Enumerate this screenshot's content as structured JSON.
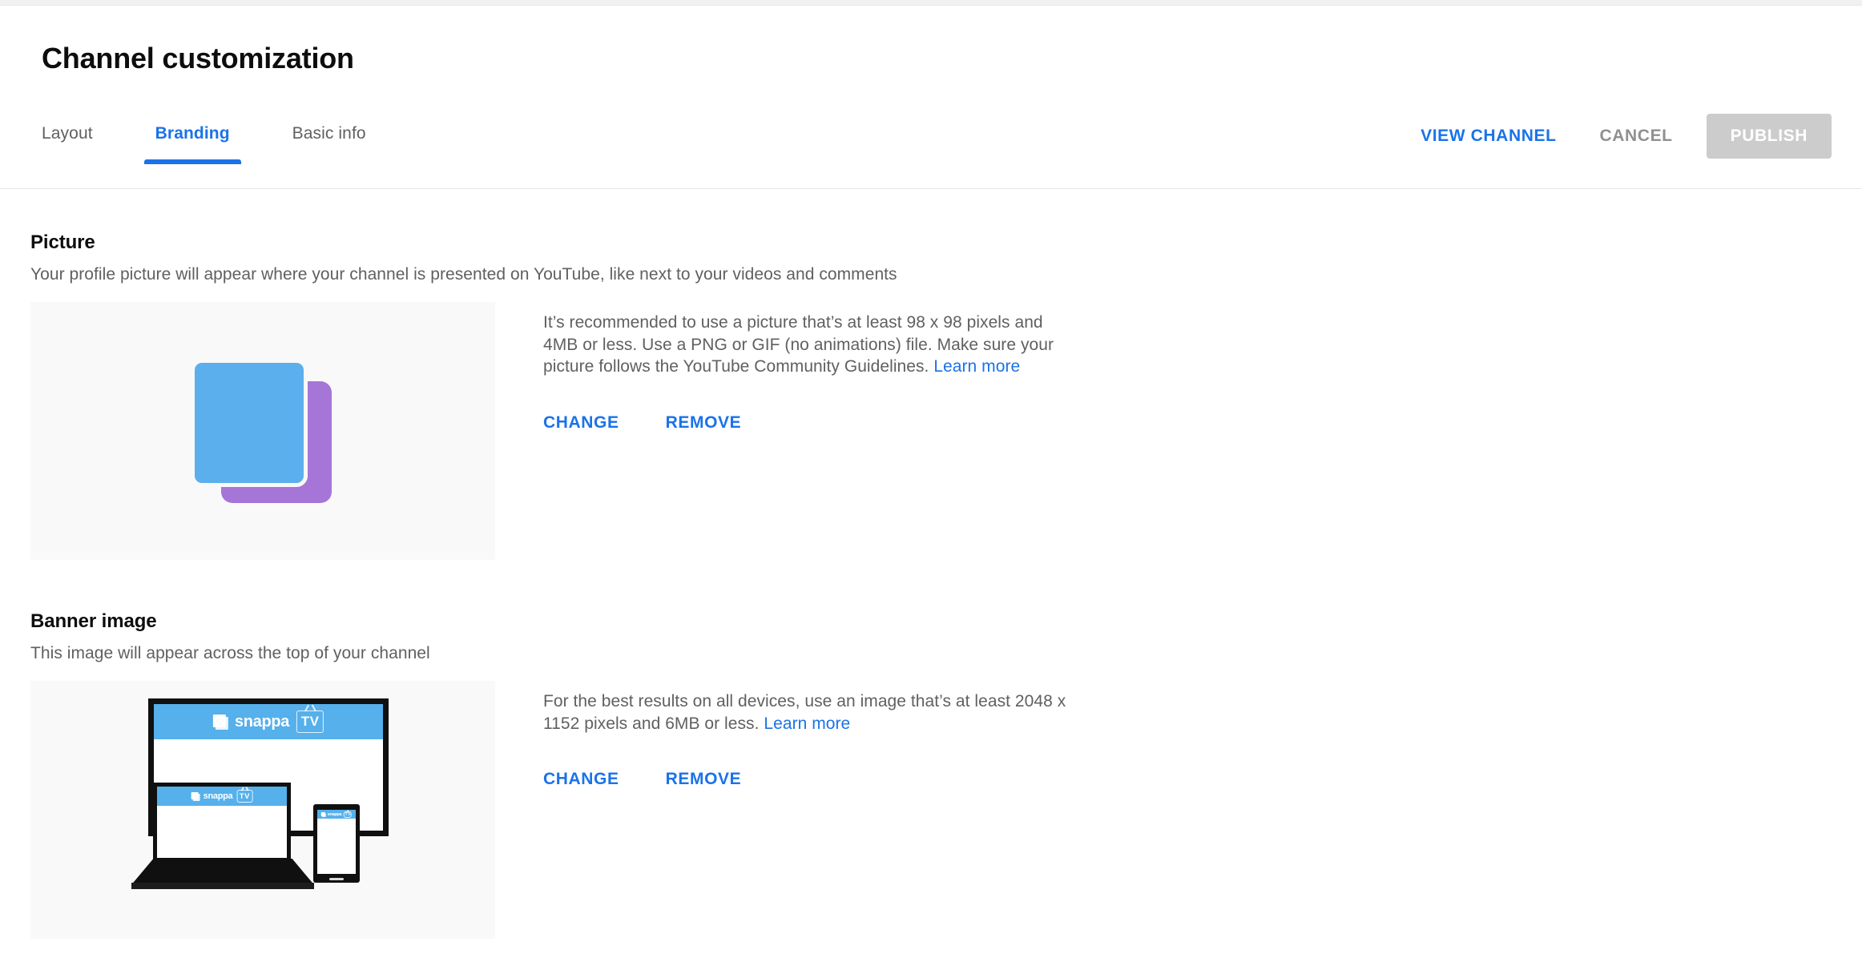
{
  "header": {
    "title": "Channel customization",
    "tabs": [
      {
        "label": "Layout",
        "active": false
      },
      {
        "label": "Branding",
        "active": true
      },
      {
        "label": "Basic info",
        "active": false
      }
    ],
    "actions": {
      "view_channel": "VIEW CHANNEL",
      "cancel": "CANCEL",
      "publish": "PUBLISH",
      "publish_disabled": true
    }
  },
  "sections": {
    "picture": {
      "title": "Picture",
      "description": "Your profile picture will appear where your channel is presented on YouTube, like next to your videos and comments",
      "info_text": "It’s recommended to use a picture that’s at least 98 x 98 pixels and 4MB or less. Use a PNG or GIF (no animations) file. Make sure your picture follows the YouTube Community Guidelines.",
      "learn_more": "Learn more",
      "change_label": "CHANGE",
      "remove_label": "REMOVE"
    },
    "banner": {
      "title": "Banner image",
      "description": "This image will appear across the top of your channel",
      "info_text": "For the best results on all devices, use an image that’s at least 2048 x 1152 pixels and 6MB or less.",
      "learn_more": "Learn more",
      "change_label": "CHANGE",
      "remove_label": "REMOVE"
    }
  },
  "banner_preview": {
    "brand_word": "snappa",
    "brand_badge": "TV"
  },
  "colors": {
    "accent_blue": "#1a73e8",
    "muted_text": "#606060",
    "placeholder_blue": "#5bafec",
    "placeholder_purple": "#a575d8",
    "banner_blue": "#55b0eb",
    "disabled_button": "#cccccc",
    "thumb_background": "#f9f9f9"
  }
}
